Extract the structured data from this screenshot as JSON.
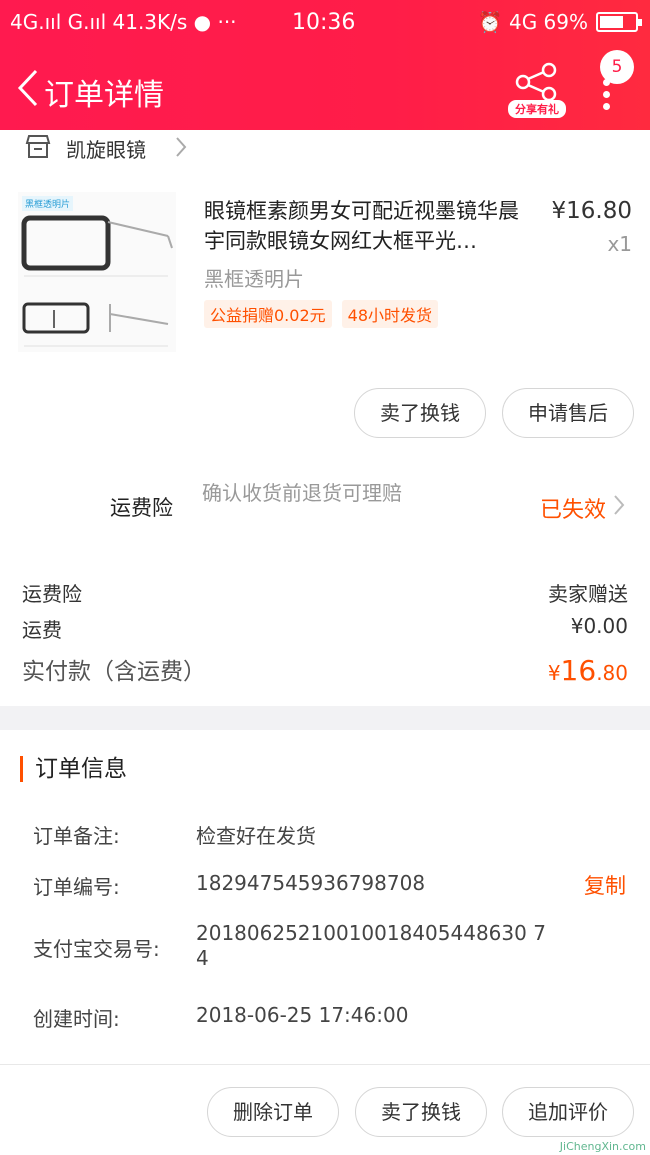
{
  "statusbar": {
    "left": "4G.ııl G.ııl 41.3K/s ● ···",
    "time": "10:36",
    "right": "⏰ 4G 69%",
    "battery_level": 0.69
  },
  "nav": {
    "title": "订单详情",
    "share_label": "分享有礼",
    "badge_count": "5"
  },
  "shop": {
    "name": "凯旋眼镜"
  },
  "product": {
    "title": "眼镜框素颜男女可配近视墨镜华晨宇同款眼镜女网红大框平光…",
    "thumb_tag": "黑框透明片",
    "price": "¥16.80",
    "quantity": "x1",
    "sku": "黑框透明片",
    "tags": [
      "公益捐赠0.02元",
      "48小时发货"
    ]
  },
  "item_buttons": {
    "sell": "卖了换钱",
    "after_sale": "申请售后"
  },
  "insurance": {
    "label": "运费险",
    "desc": "确认收货前退货可理赔",
    "status": "已失效"
  },
  "summary": {
    "insurance_label": "运费险",
    "insurance_value": "卖家赠送",
    "shipping_label": "运费",
    "shipping_value": "¥0.00",
    "paid_label": "实付款（含运费）",
    "paid_currency": "¥",
    "paid_int": "16",
    "paid_dec": ".80"
  },
  "order_info": {
    "title": "订单信息",
    "note_label": "订单备注:",
    "note_value": "检查好在发货",
    "number_label": "订单编号:",
    "number_value": "182947545936798708",
    "copy_label": "复制",
    "alipay_label": "支付宝交易号:",
    "alipay_value": "20180625210010018405448630 74",
    "created_label": "创建时间:",
    "created_value": "2018-06-25 17:46:00"
  },
  "bottom_bar": {
    "delete": "删除订单",
    "sell": "卖了换钱",
    "review": "追加评价"
  },
  "watermark": "JiChengXin.com"
}
